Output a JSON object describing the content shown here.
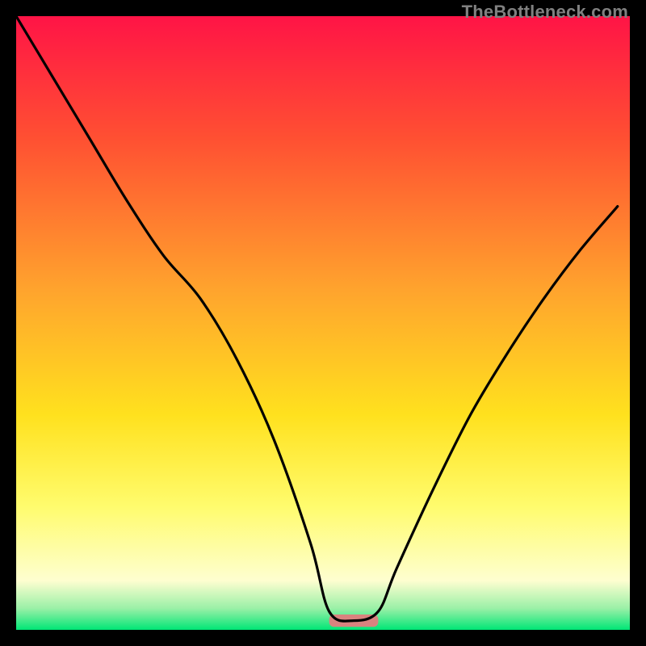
{
  "watermark": "TheBottleneck.com",
  "chart_data": {
    "type": "line",
    "title": "",
    "xlabel": "",
    "ylabel": "",
    "xlim": [
      0,
      100
    ],
    "ylim": [
      0,
      100
    ],
    "grid": false,
    "legend": false,
    "background_gradient_stops": [
      {
        "pos": 0.0,
        "color": "#ff1446"
      },
      {
        "pos": 0.2,
        "color": "#ff5032"
      },
      {
        "pos": 0.45,
        "color": "#ffa52d"
      },
      {
        "pos": 0.65,
        "color": "#ffe11e"
      },
      {
        "pos": 0.8,
        "color": "#fffc6e"
      },
      {
        "pos": 0.92,
        "color": "#fefed0"
      },
      {
        "pos": 0.965,
        "color": "#9af0a7"
      },
      {
        "pos": 1.0,
        "color": "#00e676"
      }
    ],
    "minimum_marker": {
      "x_start": 51,
      "x_end": 59,
      "y": 1.5,
      "color": "#d9837f",
      "height": 2
    },
    "series": [
      {
        "name": "bottleneck-curve",
        "color": "#000000",
        "stroke_width": 3.2,
        "x": [
          0,
          6,
          12,
          18,
          24,
          30,
          36,
          42,
          48,
          51,
          55,
          59,
          62,
          68,
          74,
          80,
          86,
          92,
          98
        ],
        "y": [
          100,
          90,
          80,
          70,
          61,
          54,
          44,
          31,
          14,
          3,
          1.5,
          3,
          10,
          23,
          35,
          45,
          54,
          62,
          69
        ]
      }
    ]
  }
}
